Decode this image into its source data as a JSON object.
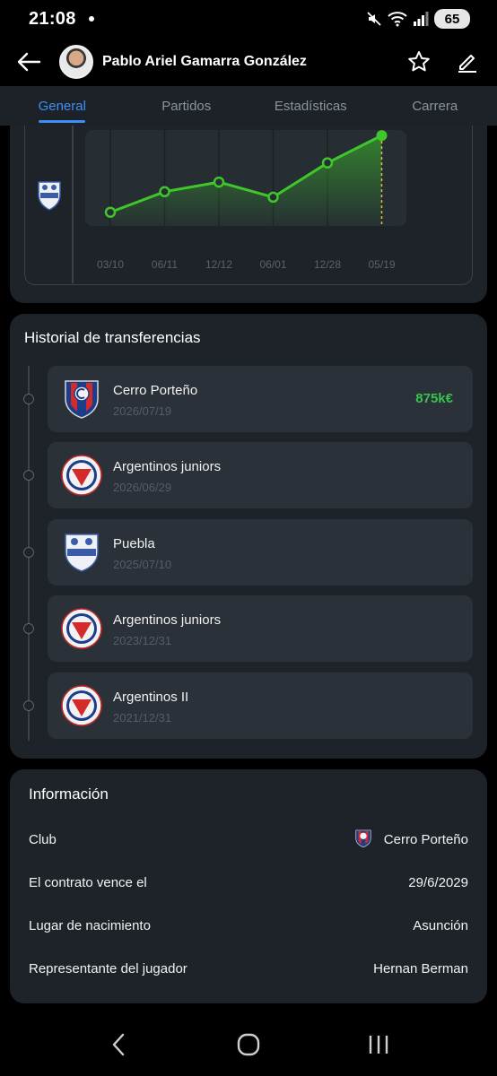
{
  "status": {
    "time": "21:08",
    "battery": "65"
  },
  "header": {
    "player_name": "Pablo Ariel Gamarra González"
  },
  "tabs": [
    {
      "label": "General",
      "active": true
    },
    {
      "label": "Partidos",
      "active": false
    },
    {
      "label": "Estadísticas",
      "active": false
    },
    {
      "label": "Carrera",
      "active": false
    }
  ],
  "chart_data": {
    "type": "line",
    "categories": [
      "03/10",
      "06/11",
      "12/12",
      "06/01",
      "12/28",
      "05/19"
    ],
    "values": [
      1,
      2.5,
      3.2,
      2.1,
      4.6,
      6.6
    ],
    "highlight_index": 5,
    "line_color": "#3fc62b",
    "y_axis_labels": "none",
    "grid": "vertical"
  },
  "transfers": {
    "title": "Historial de transferencias",
    "items": [
      {
        "club": "Cerro Porteño",
        "date": "2026/07/19",
        "fee": "875k€",
        "logo": "cerro-porteno-crest"
      },
      {
        "club": "Argentinos juniors",
        "date": "2026/06/29",
        "fee": "",
        "logo": "argentinos-juniors-crest"
      },
      {
        "club": "Puebla",
        "date": "2025/07/10",
        "fee": "",
        "logo": "puebla-crest"
      },
      {
        "club": "Argentinos juniors",
        "date": "2023/12/31",
        "fee": "",
        "logo": "argentinos-juniors-crest"
      },
      {
        "club": "Argentinos II",
        "date": "2021/12/31",
        "fee": "",
        "logo": "argentinos-juniors-crest"
      }
    ]
  },
  "info": {
    "title": "Información",
    "club_label": "Club",
    "club_value": "Cerro Porteño",
    "contract_label": "El contrato vence el",
    "contract_value": "29/6/2029",
    "birthplace_label": "Lugar de nacimiento",
    "birthplace_value": "Asunción",
    "agent_label": "Representante del jugador",
    "agent_value": "Hernan Berman"
  },
  "colors": {
    "background": "#000000",
    "card": "#1d2329",
    "item": "#2a3138",
    "accent": "#3e8ef7",
    "fee_green": "#38c24e"
  }
}
